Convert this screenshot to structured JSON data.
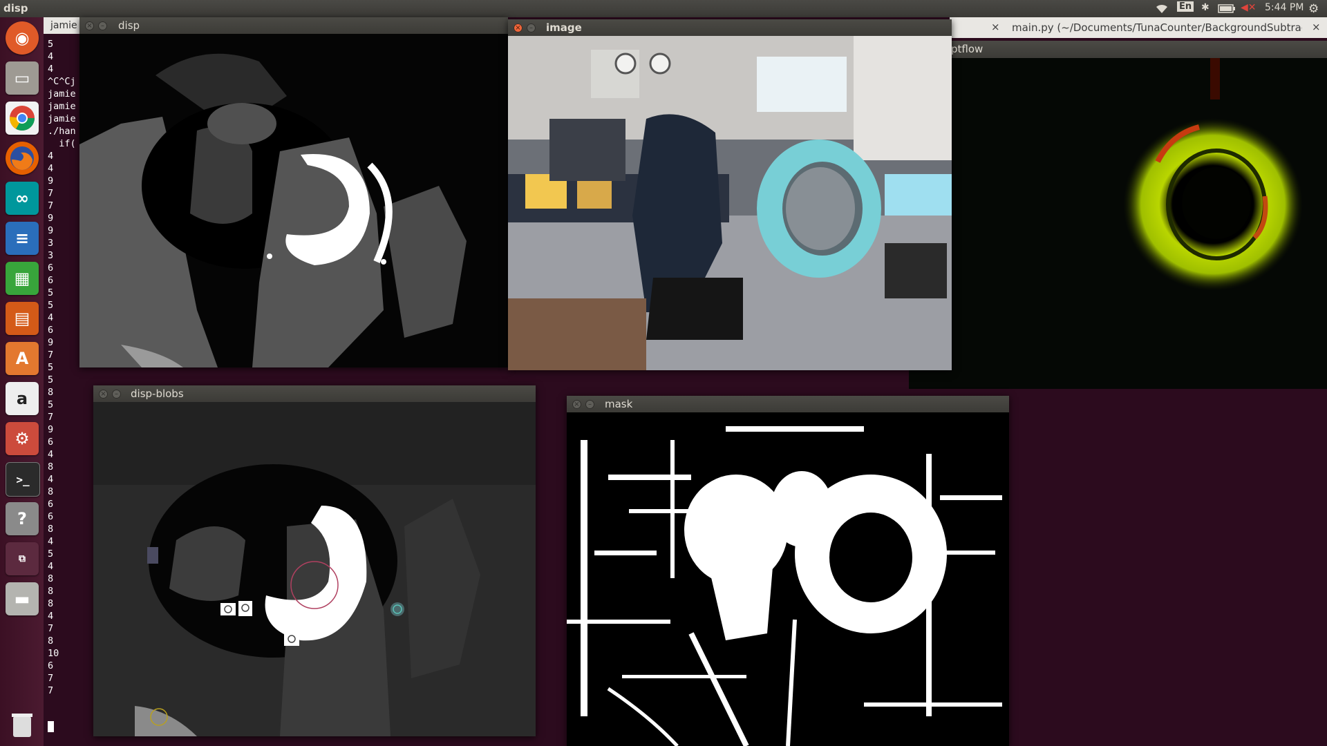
{
  "topbar": {
    "app_title": "disp",
    "keyboard": "En",
    "clock": "5:44 PM"
  },
  "launcher": {
    "items": [
      "ubuntu-dash",
      "files",
      "chrome",
      "firefox",
      "arduino",
      "writer",
      "calc",
      "impress",
      "software-center",
      "amazon",
      "system-settings",
      "terminal",
      "help",
      "workspaces",
      "drive",
      "trash"
    ]
  },
  "terminal": {
    "tab_label": "jamie",
    "lines": [
      "5",
      "4",
      "4",
      "^C^Cj",
      "jamie",
      "jamie",
      "jamie",
      "./han",
      "  if(",
      "4",
      "4",
      "9",
      "7",
      "7",
      "9",
      "9",
      "3",
      "3",
      "6",
      "6",
      "5",
      "5",
      "4",
      "6",
      "9",
      "7",
      "5",
      "5",
      "8",
      "5",
      "7",
      "9",
      "6",
      "4",
      "8",
      "4",
      "8",
      "6",
      "6",
      "8",
      "4",
      "5",
      "4",
      "8",
      "8",
      "8",
      "4",
      "7",
      "8",
      "10",
      "6",
      "7",
      "7"
    ]
  },
  "windows": {
    "disp": {
      "title": "disp"
    },
    "image": {
      "title": "image"
    },
    "disp_blobs": {
      "title": "disp-blobs"
    },
    "mask": {
      "title": "mask"
    },
    "optflow": {
      "title": "ptflow"
    }
  },
  "editor": {
    "tab_title": "main.py (~/Documents/TunaCounter/BackgroundSubtractor) ...",
    "close_glyph": "×"
  },
  "colors": {
    "desktop": "#2c0b1e",
    "close_button": "#f0663a",
    "ring_teal": "#6fc7cd",
    "optflow_yellow": "#b9d600"
  }
}
